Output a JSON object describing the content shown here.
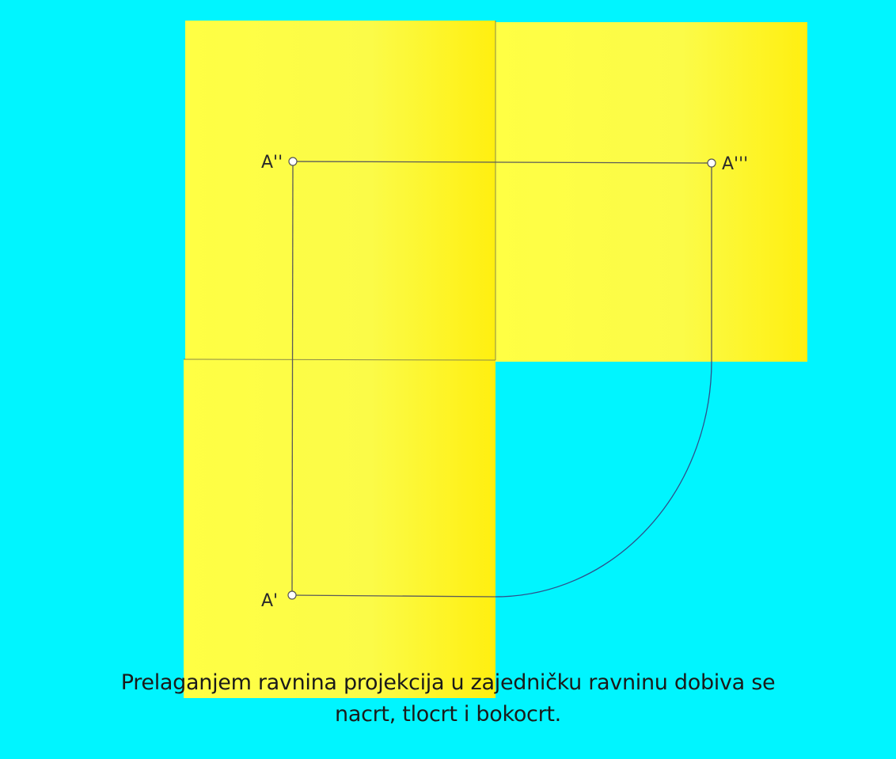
{
  "colors": {
    "background": "#00f5ff",
    "plane": "#ffff3c",
    "line": "#5a5a5a",
    "arc": "#2f4f8a"
  },
  "points": {
    "front": "A''",
    "side": "A'''",
    "top": "A'"
  },
  "caption": {
    "line1": "Prelaganjem ravnina projekcija u zajedničku ravninu dobiva se",
    "line2": "nacrt, tlocrt i bokocrt."
  }
}
